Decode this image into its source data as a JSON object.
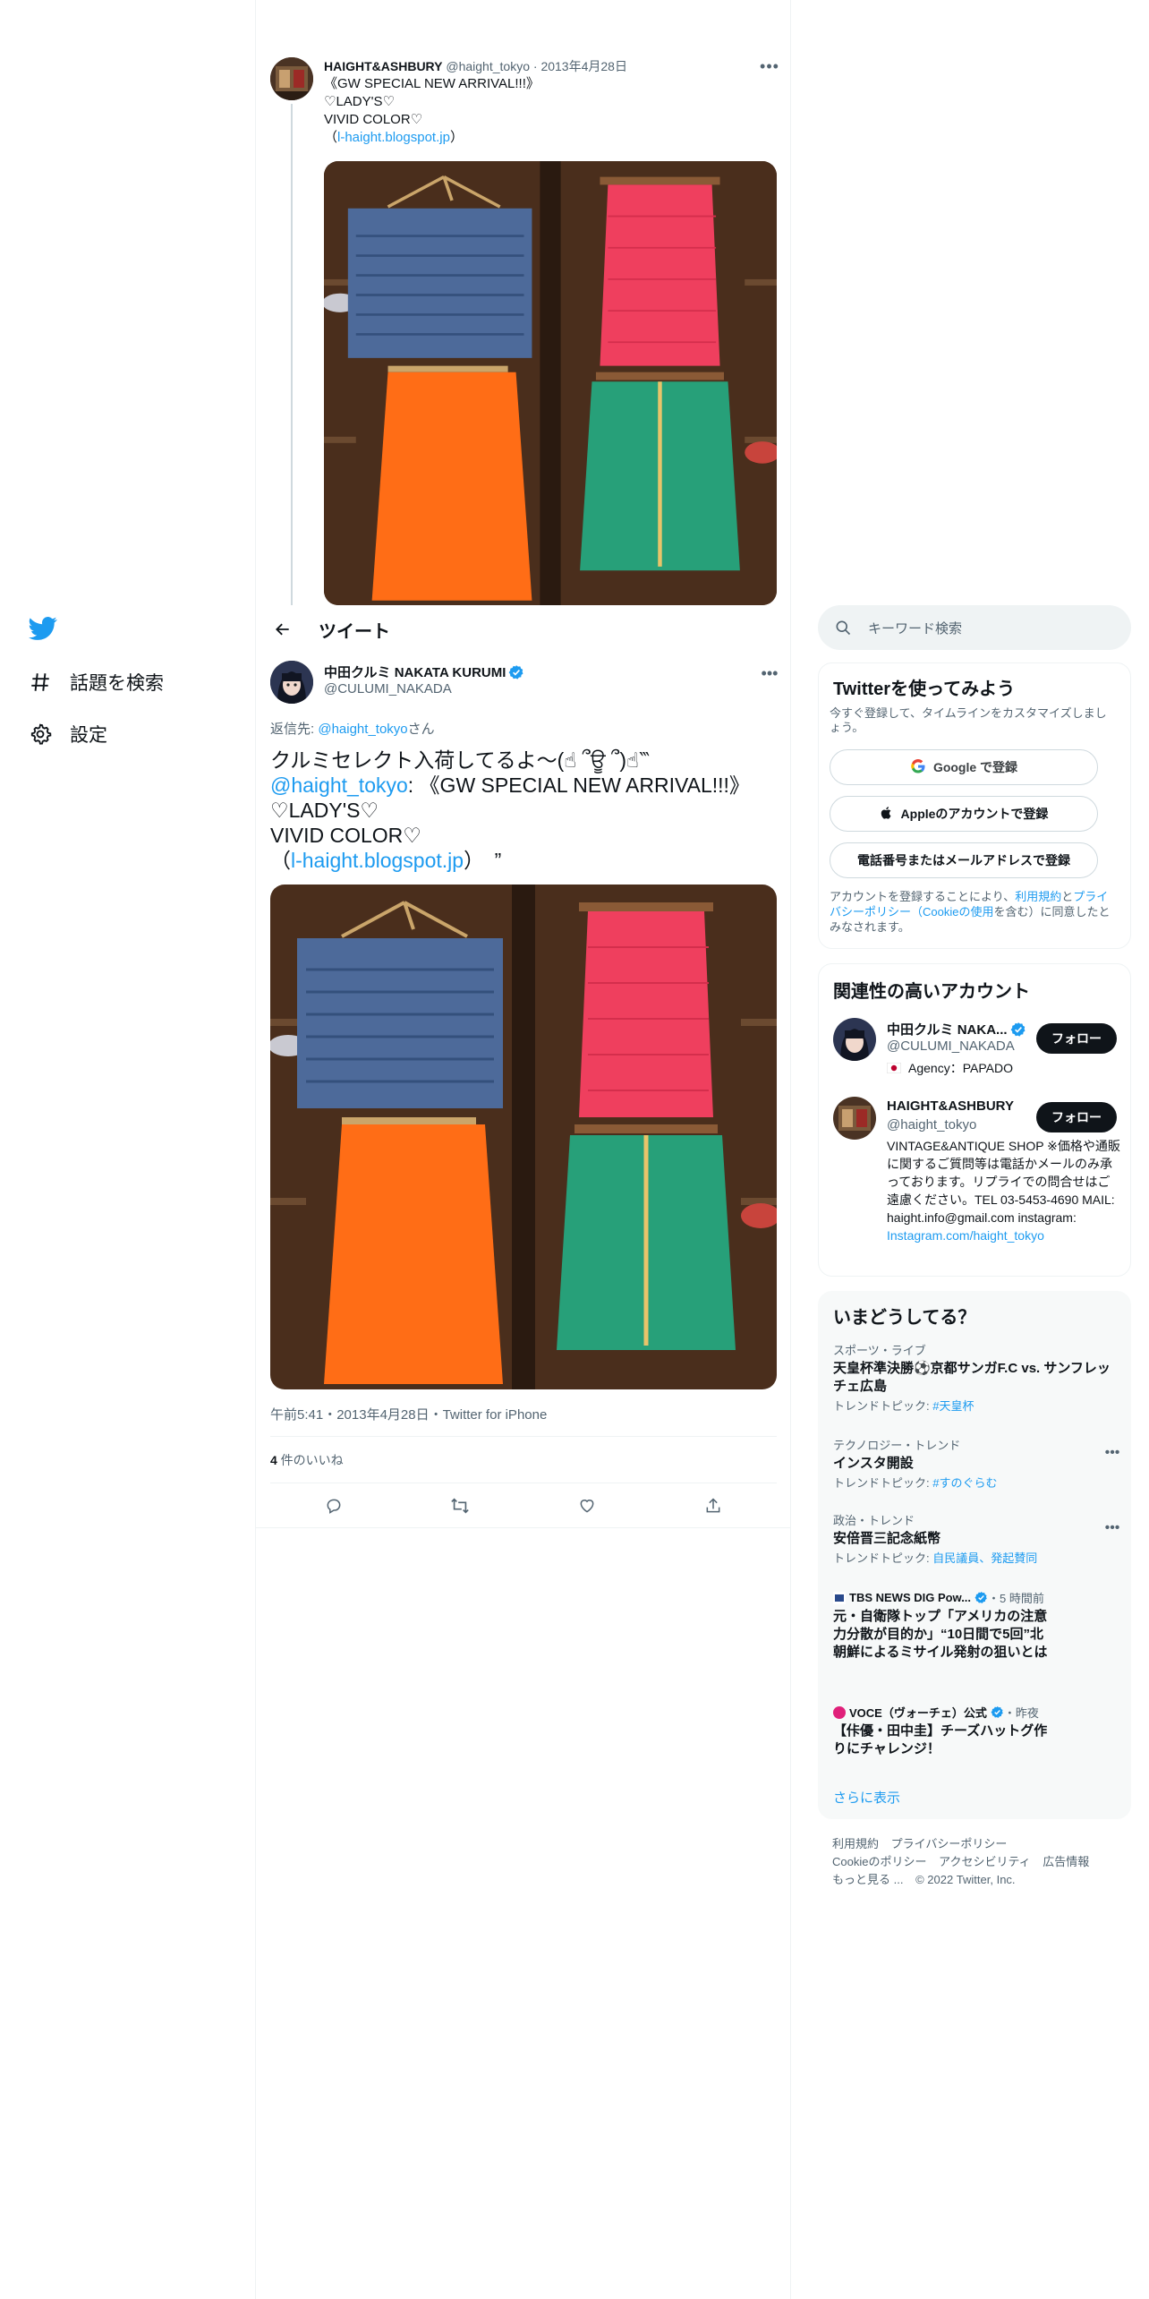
{
  "left_nav": {
    "items": [
      {
        "label": "話題を検索",
        "icon": "hashtag-icon"
      },
      {
        "label": "設定",
        "icon": "gear-icon"
      }
    ]
  },
  "parent_tweet": {
    "name": "HAIGHT&ASHBURY",
    "handle": "@haight_tokyo",
    "sep": "·",
    "date": "2013年4月28日",
    "line1": "《GW SPECIAL NEW ARRIVAL!!!》",
    "line2": "♡LADY'S♡",
    "line3": "VIVID COLOR♡",
    "link_open": "（",
    "link": "l-haight.blogspot.jp",
    "link_close": "）"
  },
  "header": {
    "title": "ツイート"
  },
  "main_tweet": {
    "name": "中田クルミ NAKATA KURUMI",
    "handle": "@CULUMI_NAKADA",
    "reply_prefix": "返信先: ",
    "reply_handle": "@haight_tokyo",
    "reply_suffix": "さん",
    "text_line1": "クルミセレクト入荷してるよ～(☝ ՞ਊ ՞)☝‷",
    "mention": "@haight_tokyo",
    "text_line2_rest": ": 《GW SPECIAL NEW ARRIVAL!!!》",
    "text_line3": "♡LADY'S♡",
    "text_line4": "VIVID COLOR♡",
    "text_link_open": "（",
    "text_link": "l-haight.blogspot.jp",
    "text_link_close": "）　”",
    "meta": "午前5:41・2013年4月28日・Twitter for iPhone",
    "likes_count": "4",
    "likes_label": " 件のいいね"
  },
  "search": {
    "placeholder": "キーワード検索"
  },
  "signup": {
    "title": "Twitterを使ってみよう",
    "subtitle": "今すぐ登録して、タイムラインをカスタマイズしましょう。",
    "google": "Google で登録",
    "apple": "Appleのアカウントで登録",
    "phone": "電話番号またはメールアドレスで登録",
    "legal_pre": "アカウントを登録することにより、",
    "legal_terms": "利用規約",
    "legal_and": "と",
    "legal_privacy": "プライバシーポリシー（Cookieの使用",
    "legal_post": "を含む）に同意したとみなされます。"
  },
  "related": {
    "title": "関連性の高いアカウント",
    "accounts": [
      {
        "name": "中田クルミ NAKA...",
        "handle": "@CULUMI_NAKADA",
        "bio": "Agency：PAPADO",
        "follow": "フォロー"
      },
      {
        "name": "HAIGHT&ASHBURY",
        "handle": "@haight_tokyo",
        "bio": "VINTAGE&ANTIQUE SHOP ※価格や通販に関するご質問等は電話かメールのみ承っております。リプライでの問合せはご遠慮ください。TEL 03-5453-4690 MAIL: haight.info@gmail.com instagram:",
        "bio_link": "Instagram.com/haight_tokyo",
        "follow": "フォロー"
      }
    ]
  },
  "trends": {
    "title": "いまどうしてる？",
    "items": [
      {
        "context": "スポーツ・ライブ",
        "title": "天皇杯準決勝⚽京都サンガF.C vs. サンフレッチェ広島",
        "sub_pre": "トレンドトピック: ",
        "sub_link": "#天皇杯"
      },
      {
        "context": "テクノロジー・トレンド",
        "title": "インスタ開設",
        "sub_pre": "トレンドトピック: ",
        "sub_link": "#すのぐらむ"
      },
      {
        "context": "政治・トレンド",
        "title": "安倍晋三記念紙幣",
        "sub_pre": "トレンドトピック: ",
        "sub_link": "自民議員、発起賛同"
      }
    ],
    "news": [
      {
        "source": "TBS NEWS DIG Pow...",
        "time": "・5 時間前",
        "title": "元・自衛隊トップ「アメリカの注意力分散が目的か」“10日間で5回”北朝鮮によるミサイル発射の狙いとは"
      },
      {
        "source": "VOCE（ヴォーチェ）公式",
        "time": "・昨夜",
        "title": "【佧優・田中圭】チーズハットグ作りにチャレンジ！"
      }
    ],
    "show_more": "さらに表示"
  },
  "footer": {
    "links": [
      "利用規約",
      "プライバシーポリシー",
      "Cookieのポリシー",
      "アクセシビリティ",
      "広告情報",
      "もっと見る ..."
    ],
    "copyright": "© 2022 Twitter, Inc."
  },
  "colors": {
    "accent": "#1d9bf0",
    "text": "#0f1419",
    "secondary": "#536471",
    "border": "#eff3f4"
  }
}
